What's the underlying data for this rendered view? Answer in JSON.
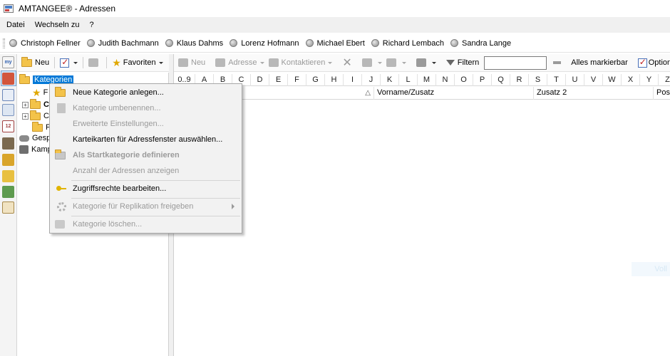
{
  "window": {
    "title": "AMTANGEE® - Adressen"
  },
  "menubar": {
    "items": [
      "Datei",
      "Wechseln zu",
      "?"
    ]
  },
  "users": [
    "Christoph Fellner",
    "Judith Bachmann",
    "Klaus Dahms",
    "Lorenz Hofmann",
    "Michael Ebert",
    "Richard Lembach",
    "Sandra Lange"
  ],
  "leftbar": {
    "my_label": "my"
  },
  "tree_toolbar": {
    "new_label": "Neu",
    "favorites_label": "Favoriten"
  },
  "tree": {
    "root_label": "Kategorien",
    "child1_label": "F",
    "child2_label": "C",
    "child3_label": "C",
    "child4_label": "F",
    "node_gesp": "Gesp",
    "node_kamp": "Kamp"
  },
  "main_toolbar": {
    "new_label": "Neu",
    "address_label": "Adresse",
    "contact_label": "Kontaktieren",
    "filter_label": "Filtern",
    "filter_value": "",
    "mark_all_label": "Alles markierbar",
    "options_label": "Optione"
  },
  "alphabet": [
    "0..9",
    "A",
    "B",
    "C",
    "D",
    "E",
    "F",
    "G",
    "H",
    "I",
    "J",
    "K",
    "L",
    "M",
    "N",
    "O",
    "P",
    "Q",
    "R",
    "S",
    "T",
    "U",
    "V",
    "W",
    "X",
    "Y",
    "Z"
  ],
  "grid": {
    "columns": [
      "",
      "Vorname/Zusatz",
      "Zusatz 2",
      "Posi"
    ]
  },
  "context_menu": {
    "items": [
      {
        "label": "Neue Kategorie anlegen...",
        "enabled": true
      },
      {
        "label": "Kategorie umbenennen...",
        "enabled": false
      },
      {
        "label": "Erweiterte Einstellungen...",
        "enabled": false
      },
      {
        "label": "Karteikarten für Adressfenster auswählen...",
        "enabled": true
      },
      {
        "label": "Als Startkategorie definieren",
        "enabled": false
      },
      {
        "label": "Anzahl der Adressen anzeigen",
        "enabled": false
      },
      {
        "label": "Zugriffsrechte bearbeiten...",
        "enabled": true
      },
      {
        "label": "Kategorie für Replikation freigeben",
        "enabled": false
      },
      {
        "label": "Kategorie löschen...",
        "enabled": false
      }
    ]
  },
  "faint_label": "Voll",
  "colors": {
    "selection": "#0078d7",
    "disabled_text": "#9a9a9a",
    "menu_bg": "#f2f2f2"
  }
}
